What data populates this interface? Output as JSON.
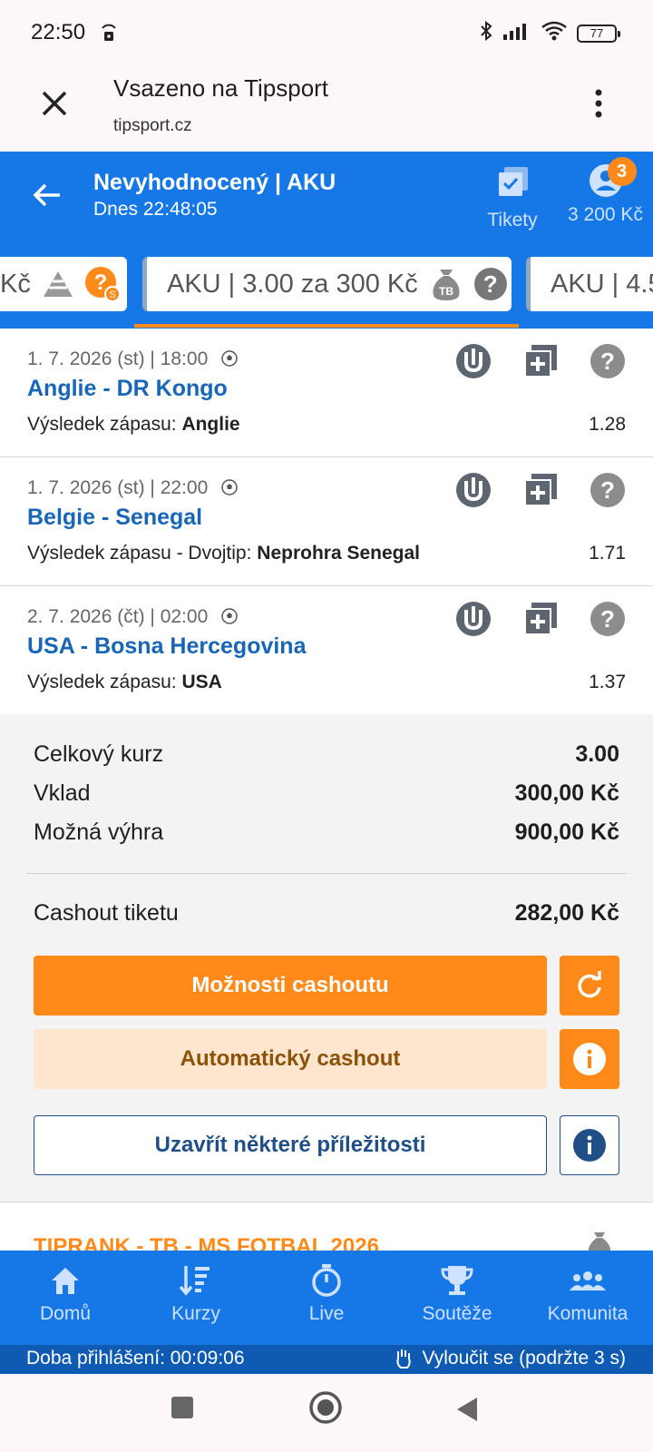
{
  "status_bar": {
    "time": "22:50",
    "battery": "77"
  },
  "browser": {
    "title": "Vsazeno na Tipsport",
    "domain": "tipsport.cz"
  },
  "header": {
    "title": "Nevyhodnocený | AKU",
    "subtitle": "Dnes 22:48:05",
    "tickets_label": "Tikety",
    "account_badge": "3",
    "balance": "3 200 Kč"
  },
  "chips": {
    "left": "Kč",
    "main": "AKU  | 3.00 za 300 Kč",
    "main_badge": "TB",
    "right": "AKU  | 4.5"
  },
  "legs": [
    {
      "date": "1. 7. 2026 (st)  | 18:00",
      "match": "Anglie - DR Kongo",
      "market": "Výsledek zápasu: ",
      "pick": "Anglie",
      "odds": "1.28"
    },
    {
      "date": "1. 7. 2026 (st)  | 22:00",
      "match": "Belgie - Senegal",
      "market": "Výsledek zápasu - Dvojtip: ",
      "pick": "Neprohra Senegal",
      "odds": "1.71"
    },
    {
      "date": "2. 7. 2026 (čt)  | 02:00",
      "match": "USA - Bosna Hercegovina",
      "market": "Výsledek zápasu: ",
      "pick": "USA",
      "odds": "1.37"
    }
  ],
  "summary": {
    "total_odds_label": "Celkový kurz",
    "total_odds": "3.00",
    "stake_label": "Vklad",
    "stake": "300,00 Kč",
    "win_label": "Možná výhra",
    "win": "900,00 Kč",
    "cashout_label": "Cashout tiketu",
    "cashout": "282,00 Kč"
  },
  "buttons": {
    "cashout_options": "Možnosti cashoutu",
    "auto_cashout": "Automatický cashout",
    "close_some": "Uzavřít některé příležitosti"
  },
  "peek": {
    "text": "TIPRANK - TB - MS FOTBAL 2026"
  },
  "nav": [
    {
      "label": "Domů",
      "icon": "home-icon"
    },
    {
      "label": "Kurzy",
      "icon": "odds-sort-icon"
    },
    {
      "label": "Live",
      "icon": "stopwatch-icon"
    },
    {
      "label": "Soutěže",
      "icon": "trophy-icon"
    },
    {
      "label": "Komunita",
      "icon": "community-icon"
    }
  ],
  "login_bar": {
    "left": "Doba přihlášení: 00:09:06",
    "right": "Vyloučit se (podržte 3 s)"
  },
  "colors": {
    "brand_blue": "#1677e6",
    "accent_orange": "#ff8a1a",
    "link_blue": "#1766b8"
  }
}
